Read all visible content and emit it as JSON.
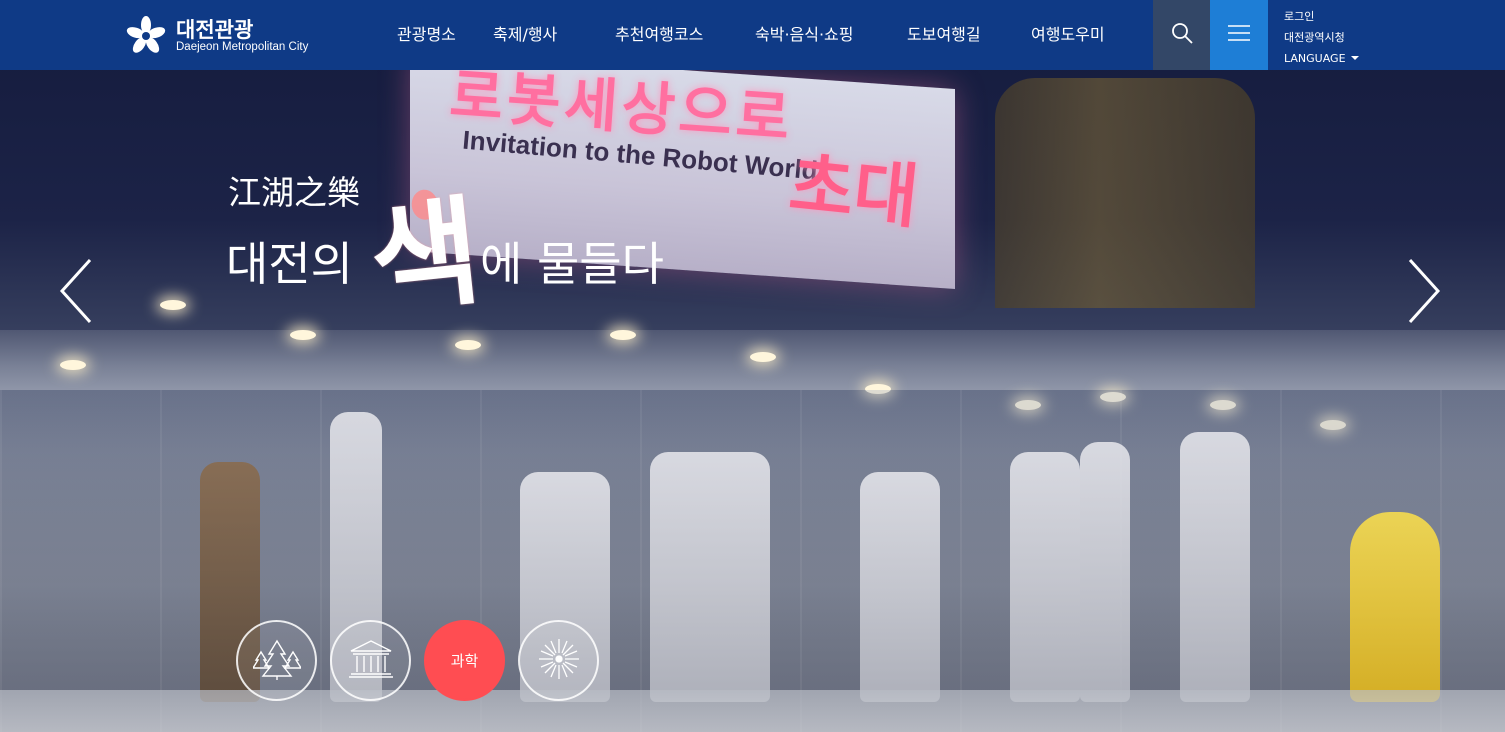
{
  "header": {
    "logo": {
      "title": "대전관광",
      "subtitle": "Daejeon Metropolitan City",
      "icon": "daejeon-star-logo-icon"
    },
    "nav": [
      {
        "label": "관광명소"
      },
      {
        "label": "축제/행사"
      },
      {
        "label": "추천여행코스"
      },
      {
        "label": "숙박·음식·쇼핑"
      },
      {
        "label": "도보여행길"
      },
      {
        "label": "여행도우미"
      }
    ],
    "search_icon": "search-icon",
    "menu_icon": "hamburger-menu-icon",
    "util": {
      "login": "로그인",
      "city_hall": "대전광역시청",
      "language": "LANGUAGE"
    }
  },
  "hero": {
    "slogan_hanja": "江湖之樂",
    "slogan_part1": "대전의",
    "slogan_color": "색",
    "slogan_part2": "에 물들다",
    "photo_sign_ko": "로봇세상으로",
    "photo_sign_en": "Invitation to the Robot World",
    "photo_sign_ko2": "초대"
  },
  "carousel": {
    "prev_icon": "chevron-left-icon",
    "next_icon": "chevron-right-icon"
  },
  "themes": [
    {
      "icon": "forest-trees-icon",
      "label": ""
    },
    {
      "icon": "museum-building-icon",
      "label": ""
    },
    {
      "icon": "",
      "label": "과학"
    },
    {
      "icon": "firework-icon",
      "label": ""
    }
  ],
  "colors": {
    "header_bg": "#0f3a86",
    "search_bg": "#334767",
    "menu_bg": "#1e7ed6",
    "active_theme": "#ff4d52"
  }
}
